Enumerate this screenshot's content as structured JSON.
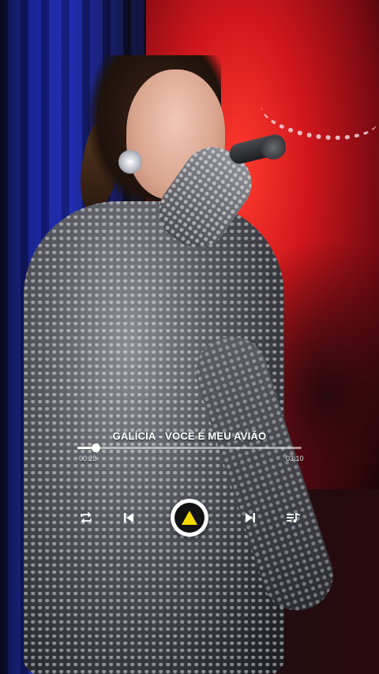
{
  "player": {
    "track_title": "GALÍCIA - VOCÊ É MEU AVIÃO",
    "elapsed": "00:28",
    "duration": "03:10",
    "progress": 0.08
  },
  "controls": {
    "repeat_icon": "repeat-icon",
    "previous_icon": "skip-previous-icon",
    "play_icon": "play-icon",
    "next_icon": "skip-next-icon",
    "queue_icon": "queue-music-icon"
  },
  "colors": {
    "accent": "#f5d800",
    "text": "#ffffff"
  }
}
